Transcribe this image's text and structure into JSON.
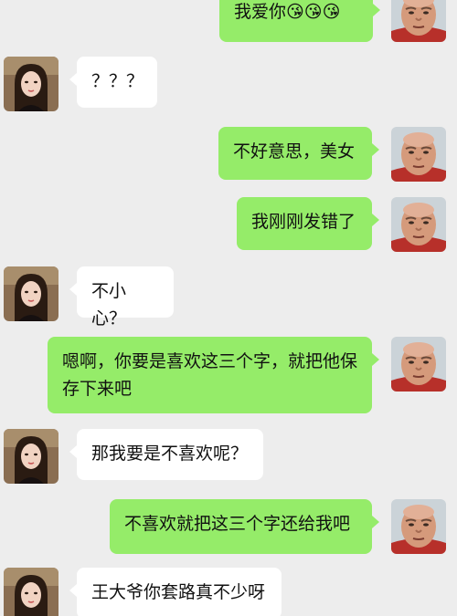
{
  "conversation": {
    "messages": [
      {
        "sender": "me",
        "text": "我爱你😘😘😘"
      },
      {
        "sender": "her",
        "text": "？？？"
      },
      {
        "sender": "me",
        "text": "不好意思，美女"
      },
      {
        "sender": "me",
        "text": "我刚刚发错了"
      },
      {
        "sender": "her",
        "text": "不小心？"
      },
      {
        "sender": "me",
        "text": "嗯啊，你要是喜欢这三个字，就把他保存下来吧"
      },
      {
        "sender": "her",
        "text": "那我要是不喜欢呢？"
      },
      {
        "sender": "me",
        "text": "不喜欢就把这三个字还给我吧"
      },
      {
        "sender": "her",
        "text": "王大爷你套路真不少呀"
      }
    ]
  },
  "colors": {
    "background": "#ededed",
    "my_bubble": "#95ec69",
    "their_bubble": "#ffffff"
  }
}
